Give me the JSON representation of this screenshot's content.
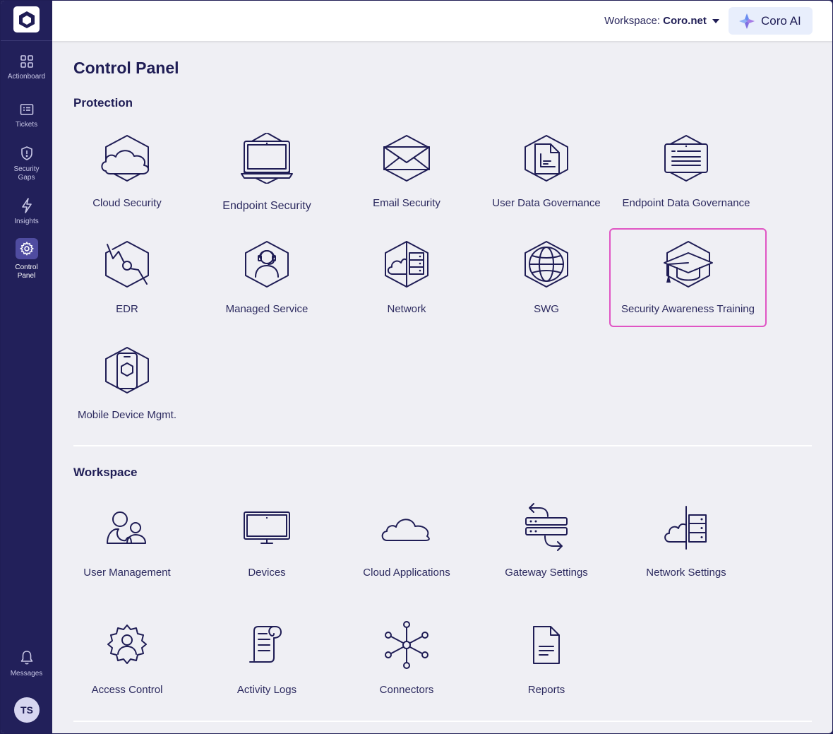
{
  "sidebar": {
    "items": [
      {
        "label": "Actionboard",
        "icon": "grid-icon"
      },
      {
        "label": "Tickets",
        "icon": "ticket-icon"
      },
      {
        "label_line1": "Security",
        "label_line2": "Gaps",
        "icon": "shield-icon"
      },
      {
        "label": "Insights",
        "icon": "lightning-icon"
      },
      {
        "label_line1": "Control",
        "label_line2": "Panel",
        "icon": "gear-icon",
        "active": true
      },
      {
        "label": "Messages",
        "icon": "bell-icon"
      }
    ],
    "avatar_initials": "TS"
  },
  "header": {
    "workspace_label": "Workspace:",
    "workspace_value": "Coro.net",
    "ai_button": "Coro AI"
  },
  "page": {
    "title": "Control Panel"
  },
  "protection": {
    "title": "Protection",
    "tiles": [
      {
        "label": "Cloud Security",
        "icon": "cloud-security-icon"
      },
      {
        "label": "Endpoint Security",
        "icon": "endpoint-security-icon"
      },
      {
        "label": "Email Security",
        "icon": "email-security-icon"
      },
      {
        "label": "User Data Governance",
        "icon": "user-data-governance-icon"
      },
      {
        "label": "Endpoint Data Governance",
        "icon": "endpoint-data-governance-icon"
      },
      {
        "label": "EDR",
        "icon": "edr-icon"
      },
      {
        "label": "Managed Service",
        "icon": "managed-service-icon"
      },
      {
        "label": "Network",
        "icon": "network-icon"
      },
      {
        "label": "SWG",
        "icon": "swg-icon"
      },
      {
        "label": "Security Awareness Training",
        "icon": "graduation-cap-icon",
        "highlighted": true
      },
      {
        "label": "Mobile Device Mgmt.",
        "icon": "mobile-device-icon"
      }
    ]
  },
  "workspace": {
    "title": "Workspace",
    "tiles": [
      {
        "label": "User Management",
        "icon": "users-icon"
      },
      {
        "label": "Devices",
        "icon": "monitor-icon"
      },
      {
        "label": "Cloud Applications",
        "icon": "cloud-icon"
      },
      {
        "label": "Gateway Settings",
        "icon": "gateway-icon"
      },
      {
        "label": "Network Settings",
        "icon": "network-settings-icon"
      },
      {
        "label": "Access Control",
        "icon": "access-control-icon"
      },
      {
        "label": "Activity Logs",
        "icon": "scroll-icon"
      },
      {
        "label": "Connectors",
        "icon": "connectors-icon"
      },
      {
        "label": "Reports",
        "icon": "document-icon"
      }
    ]
  },
  "colors": {
    "sidebar_bg": "#22205a",
    "content_bg": "#efeff4",
    "ink": "#1f1d55",
    "highlight_border": "#e055c4"
  }
}
